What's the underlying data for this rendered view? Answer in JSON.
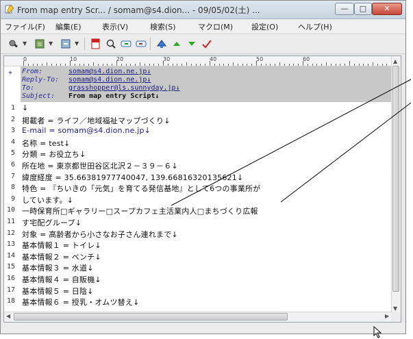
{
  "window": {
    "title": "From map entry Scr... / somam@s4.dion... - 09/05/02(土) ...",
    "minimize_glyph": "—",
    "maximize_glyph": "□",
    "close_glyph": "✕"
  },
  "menu": {
    "items": [
      "ファイル(F)",
      "編集(E)",
      "表示(V)",
      "検索(S)",
      "マクロ(M)",
      "設定(O)",
      "ヘルプ(H)"
    ]
  },
  "toolbar": {
    "icons": [
      "document-find-icon",
      "grep-icon",
      "replace-icon",
      "bookmark-icon",
      "search-icon",
      "find-next-icon",
      "find-prev-icon",
      "jump-icon",
      "up-arrow-icon",
      "down-arrow-icon",
      "check-icon"
    ]
  },
  "ruler": {
    "marks": [
      "0",
      "10",
      "20",
      "30",
      "40",
      "50",
      "60"
    ]
  },
  "header": {
    "fold_marker": "+",
    "from_label": "From:",
    "from_value": "somam@s4.dion.ne.jp↓",
    "reply_label": "Reply-To:",
    "reply_value": "somam@s4.dion.ne.jp↓",
    "to_label": "To:",
    "to_value": "grasshopper@ls.sunnyday.jp↓",
    "subject_label": "Subject:",
    "subject_value": "From map entry Script↓"
  },
  "lines": [
    {
      "num": "1",
      "text": "↓"
    },
    {
      "num": "2",
      "text": "掲載者 = ライフ／地域福祉マップづくり↓"
    },
    {
      "num": "3",
      "text": "E-mail = somam@s4.dion.ne.jp↓"
    },
    {
      "num": "4",
      "text": "名称 = test↓"
    },
    {
      "num": "5",
      "text": "分類 = お役立ち↓"
    },
    {
      "num": "6",
      "text": "所在地 = 東京都世田谷区北沢２－３９－６↓"
    },
    {
      "num": "7",
      "text": "緯度経度 = 35.66381977740047, 139.66816320135621↓"
    },
    {
      "num": "8",
      "text": "特色 = 『ちいきの「元気」を育てる発信基地』として6つの事業所が"
    },
    {
      "num": "9",
      "text": "しています。↓"
    },
    {
      "num": "10",
      "text": "一時保育所□ギャラリー□スープカフェ主活業内人□まちづくり広報"
    },
    {
      "num": "11",
      "text": "す宅配グループ↓"
    },
    {
      "num": "12",
      "text": "対象 = 高齢者から小さなお子さん連れまで↓"
    },
    {
      "num": "13",
      "text": "基本情報１ = トイレ↓"
    },
    {
      "num": "14",
      "text": "基本情報２ = ベンチ↓"
    },
    {
      "num": "15",
      "text": "基本情報３ = 水道↓"
    },
    {
      "num": "16",
      "text": "基本情報４ = 自販機↓"
    },
    {
      "num": "17",
      "text": "基本情報５ = 日陰↓"
    },
    {
      "num": "18",
      "text": "基本情報６ = 授乳・オムツ替え↓"
    }
  ],
  "colors": {
    "header_bg": "#c8c8c8",
    "link": "#1a1a8a",
    "label": "#2a2a9a"
  }
}
